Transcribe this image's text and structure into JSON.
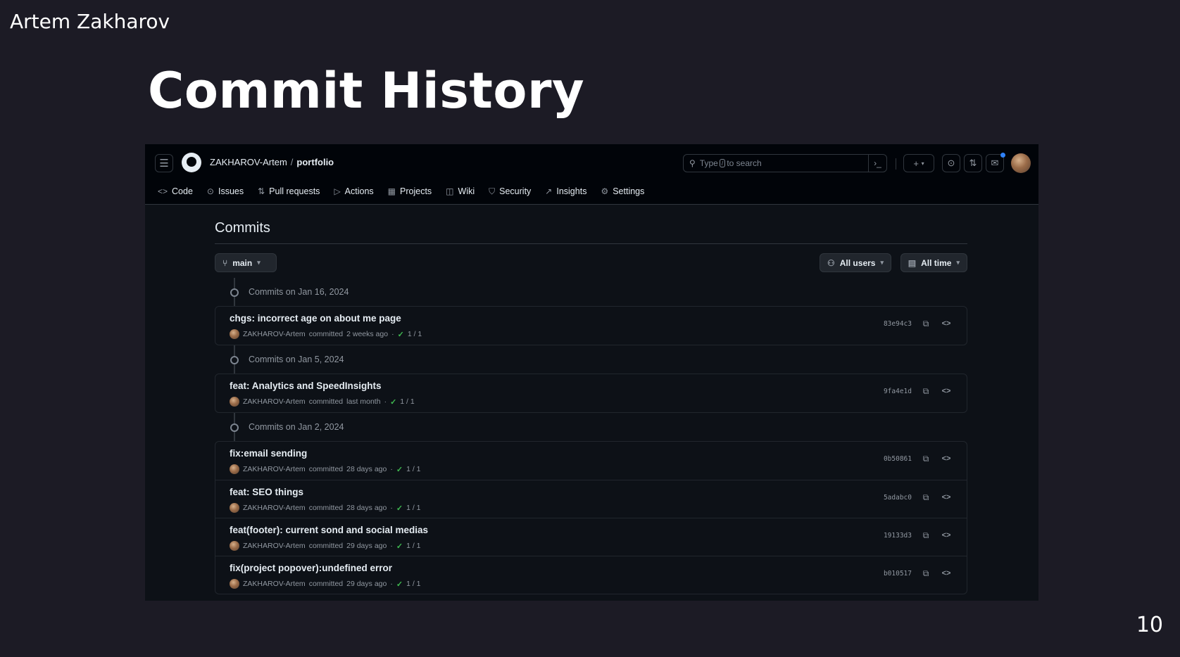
{
  "slide": {
    "author": "Artem Zakharov",
    "title": "Commit History",
    "page_number": "10"
  },
  "header": {
    "owner": "ZAKHAROV-Artem",
    "separator": "/",
    "repo": "portfolio",
    "search": {
      "prefix": "Type",
      "key": "/",
      "suffix": "to search"
    }
  },
  "tabs": [
    {
      "label": "Code",
      "icon": "code-icon"
    },
    {
      "label": "Issues",
      "icon": "issue-icon"
    },
    {
      "label": "Pull requests",
      "icon": "pull-request-icon"
    },
    {
      "label": "Actions",
      "icon": "play-icon"
    },
    {
      "label": "Projects",
      "icon": "table-icon"
    },
    {
      "label": "Wiki",
      "icon": "book-icon"
    },
    {
      "label": "Security",
      "icon": "shield-icon"
    },
    {
      "label": "Insights",
      "icon": "graph-icon"
    },
    {
      "label": "Settings",
      "icon": "gear-icon"
    }
  ],
  "main": {
    "title": "Commits",
    "branch": "main",
    "filter_users": "All users",
    "filter_time": "All time"
  },
  "groups": [
    {
      "date": "Commits on Jan 16, 2024",
      "commits": [
        {
          "message": "chgs: incorrect age on about me page",
          "author": "ZAKHAROV-Artem",
          "action": "committed",
          "when": "2 weeks ago",
          "checks": "1 / 1",
          "sha": "83e94c3"
        }
      ]
    },
    {
      "date": "Commits on Jan 5, 2024",
      "commits": [
        {
          "message": "feat: Analytics and SpeedInsights",
          "author": "ZAKHAROV-Artem",
          "action": "committed",
          "when": "last month",
          "checks": "1 / 1",
          "sha": "9fa4e1d"
        }
      ]
    },
    {
      "date": "Commits on Jan 2, 2024",
      "commits": [
        {
          "message": "fix:email sending",
          "author": "ZAKHAROV-Artem",
          "action": "committed",
          "when": "28 days ago",
          "checks": "1 / 1",
          "sha": "0b50861"
        },
        {
          "message": "feat: SEO things",
          "author": "ZAKHAROV-Artem",
          "action": "committed",
          "when": "28 days ago",
          "checks": "1 / 1",
          "sha": "5adabc0"
        },
        {
          "message": "feat(footer): current sond and social medias",
          "author": "ZAKHAROV-Artem",
          "action": "committed",
          "when": "29 days ago",
          "checks": "1 / 1",
          "sha": "19133d3"
        },
        {
          "message": "fix(project popover):undefined error",
          "author": "ZAKHAROV-Artem",
          "action": "committed",
          "when": "29 days ago",
          "checks": "1 / 1",
          "sha": "b010517"
        }
      ]
    }
  ],
  "colors": {
    "slide_bg": "#1c1b25",
    "page_bg": "#0d1117",
    "header_bg": "#010409",
    "success": "#3fb950",
    "accent": "#2f81f7"
  }
}
